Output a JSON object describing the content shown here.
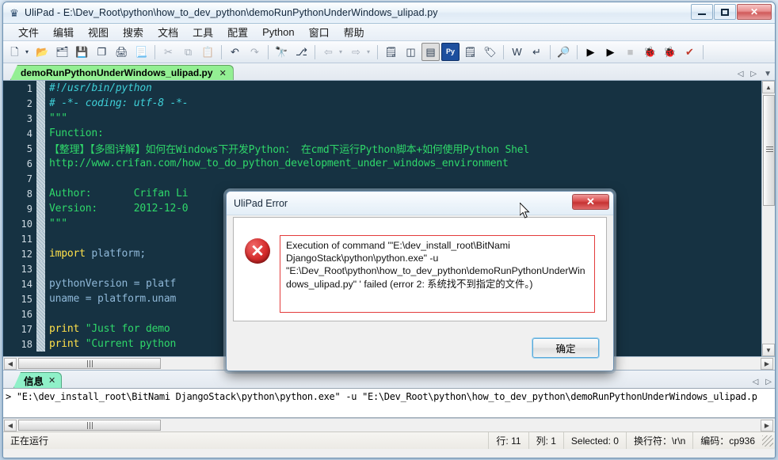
{
  "window": {
    "title": "UliPad - E:\\Dev_Root\\python\\how_to_dev_python\\demoRunPythonUnderWindows_ulipad.py",
    "app_icon": "ulipad-icon",
    "minimize_label": "–",
    "maximize_label": "□",
    "close_label": "✕"
  },
  "menubar": {
    "items": [
      {
        "label": "文件",
        "name": "menu-file"
      },
      {
        "label": "编辑",
        "name": "menu-edit"
      },
      {
        "label": "视图",
        "name": "menu-view"
      },
      {
        "label": "搜索",
        "name": "menu-search"
      },
      {
        "label": "文档",
        "name": "menu-document"
      },
      {
        "label": "工具",
        "name": "menu-tools"
      },
      {
        "label": "配置",
        "name": "menu-config"
      },
      {
        "label": "Python",
        "name": "menu-python"
      },
      {
        "label": "窗口",
        "name": "menu-window"
      },
      {
        "label": "帮助",
        "name": "menu-help"
      }
    ]
  },
  "toolbar": {
    "buttons": [
      {
        "name": "new-file-icon",
        "glyph": "🗋",
        "title": "New",
        "state": "normal"
      },
      {
        "name": "new-file-dropdown-icon",
        "glyph": "▾",
        "title": "New dropdown",
        "state": "arrow"
      },
      {
        "name": "open-file-icon",
        "glyph": "📂",
        "title": "Open",
        "state": "normal"
      },
      {
        "name": "open-folder-icon",
        "glyph": "🗂",
        "title": "Open folder",
        "state": "normal"
      },
      {
        "name": "save-icon",
        "glyph": "💾",
        "title": "Save",
        "state": "normal"
      },
      {
        "name": "save-all-icon",
        "glyph": "❐",
        "title": "Save all",
        "state": "normal"
      },
      {
        "name": "print-icon",
        "glyph": "🖨",
        "title": "Print",
        "state": "normal"
      },
      {
        "name": "print-preview-icon",
        "glyph": "📃",
        "title": "Print preview",
        "state": "normal"
      },
      {
        "name": "separator-1",
        "glyph": "",
        "title": "",
        "state": "sep"
      },
      {
        "name": "cut-icon",
        "glyph": "✂",
        "title": "Cut",
        "state": "dim"
      },
      {
        "name": "copy-icon",
        "glyph": "⧉",
        "title": "Copy",
        "state": "dim"
      },
      {
        "name": "paste-icon",
        "glyph": "📋",
        "title": "Paste",
        "state": "dim"
      },
      {
        "name": "separator-2",
        "glyph": "",
        "title": "",
        "state": "sep"
      },
      {
        "name": "undo-icon",
        "glyph": "↶",
        "title": "Undo",
        "state": "normal"
      },
      {
        "name": "redo-icon",
        "glyph": "↷",
        "title": "Redo",
        "state": "dim"
      },
      {
        "name": "separator-3",
        "glyph": "",
        "title": "",
        "state": "sep"
      },
      {
        "name": "find-icon",
        "glyph": "🔭",
        "title": "Find",
        "state": "normal"
      },
      {
        "name": "replace-icon",
        "glyph": "⎇",
        "title": "Replace",
        "state": "normal"
      },
      {
        "name": "separator-4",
        "glyph": "",
        "title": "",
        "state": "sep"
      },
      {
        "name": "back-icon",
        "glyph": "⇦",
        "title": "Back",
        "state": "dim"
      },
      {
        "name": "back-dropdown-icon",
        "glyph": "▾",
        "title": "Back history",
        "state": "arrow-dim"
      },
      {
        "name": "forward-icon",
        "glyph": "⇨",
        "title": "Forward",
        "state": "dim"
      },
      {
        "name": "forward-dropdown-icon",
        "glyph": "▾",
        "title": "Forward history",
        "state": "arrow-dim"
      },
      {
        "name": "separator-5",
        "glyph": "",
        "title": "",
        "state": "sep"
      },
      {
        "name": "preferences-icon",
        "glyph": "🗒",
        "title": "Preferences",
        "state": "normal"
      },
      {
        "name": "split-vertical-icon",
        "glyph": "◫",
        "title": "Split vertical",
        "state": "normal"
      },
      {
        "name": "split-horizontal-icon",
        "glyph": "▤",
        "title": "Split horizontal",
        "state": "pressed"
      },
      {
        "name": "python-shell-icon",
        "glyph": "Py",
        "title": "Python shell",
        "state": "normal"
      },
      {
        "name": "note-icon",
        "glyph": "🗒",
        "title": "Note",
        "state": "normal"
      },
      {
        "name": "tag-icon",
        "glyph": "🏷",
        "title": "Tag",
        "state": "normal"
      },
      {
        "name": "separator-6",
        "glyph": "",
        "title": "",
        "state": "sep"
      },
      {
        "name": "wrap-lines-icon",
        "glyph": "W",
        "title": "Wrap lines",
        "state": "normal"
      },
      {
        "name": "whitespace-icon",
        "glyph": "↵",
        "title": "Show whitespace",
        "state": "normal"
      },
      {
        "name": "separator-7",
        "glyph": "",
        "title": "",
        "state": "sep"
      },
      {
        "name": "inspect-icon",
        "glyph": "🔎",
        "title": "Inspect",
        "state": "normal"
      },
      {
        "name": "separator-8",
        "glyph": "",
        "title": "",
        "state": "sep"
      },
      {
        "name": "run-icon",
        "glyph": "▶",
        "title": "Run",
        "state": "normal"
      },
      {
        "name": "run-step-icon",
        "glyph": "▶",
        "title": "Run with arguments",
        "state": "normal"
      },
      {
        "name": "stop-icon",
        "glyph": "■",
        "title": "Stop",
        "state": "dim"
      },
      {
        "name": "debug-icon",
        "glyph": "🐞",
        "title": "Debug",
        "state": "normal"
      },
      {
        "name": "debug-run-icon",
        "glyph": "🐞",
        "title": "Debug run",
        "state": "normal"
      },
      {
        "name": "check-spelling-icon",
        "glyph": "✔",
        "title": "Check",
        "state": "normal"
      },
      {
        "name": "separator-9",
        "glyph": "",
        "title": "",
        "state": "sep"
      }
    ]
  },
  "tabbar": {
    "tabs": [
      {
        "label": "demoRunPythonUnderWindows_ulipad.py",
        "close": "✕",
        "active": true
      }
    ],
    "nav_prev": "◁",
    "nav_next": "▷",
    "nav_list": "▼"
  },
  "editor": {
    "lines": [
      {
        "no": "1",
        "segments": [
          {
            "t": "#!/usr/bin/python",
            "c": "c-comment"
          }
        ]
      },
      {
        "no": "2",
        "segments": [
          {
            "t": "# -*- coding: utf-8 -*-",
            "c": "c-comment"
          }
        ]
      },
      {
        "no": "3",
        "segments": [
          {
            "t": "\"\"\"",
            "c": "c-green"
          }
        ]
      },
      {
        "no": "4",
        "segments": [
          {
            "t": "Function:",
            "c": "c-green"
          }
        ]
      },
      {
        "no": "5",
        "segments": [
          {
            "t": "【整理】【多图详解】如何在Windows下开发Python： 在cmd下运行Python脚本+如何使用Python Shel",
            "c": "c-green"
          }
        ]
      },
      {
        "no": "6",
        "segments": [
          {
            "t": "http://www.crifan.com/how_to_do_python_development_under_windows_environment",
            "c": "c-green"
          }
        ]
      },
      {
        "no": "7",
        "segments": [
          {
            "t": "",
            "c": "c-green"
          }
        ]
      },
      {
        "no": "8",
        "segments": [
          {
            "t": "Author:       Crifan Li",
            "c": "c-green"
          }
        ]
      },
      {
        "no": "9",
        "segments": [
          {
            "t": "Version:      2012-12-0",
            "c": "c-green"
          }
        ]
      },
      {
        "no": "10",
        "segments": [
          {
            "t": "\"\"\"",
            "c": "c-green"
          }
        ]
      },
      {
        "no": "11",
        "segments": [
          {
            "t": "",
            "c": "c-green"
          }
        ]
      },
      {
        "no": "12",
        "segments": [
          {
            "t": "import ",
            "c": "c-kw"
          },
          {
            "t": "platform;",
            "c": "c-plain"
          }
        ]
      },
      {
        "no": "13",
        "segments": [
          {
            "t": "",
            "c": "c-green"
          }
        ]
      },
      {
        "no": "14",
        "segments": [
          {
            "t": "pythonVersion = platf",
            "c": "c-plain"
          }
        ]
      },
      {
        "no": "15",
        "segments": [
          {
            "t": "uname = platform.unam",
            "c": "c-plain"
          }
        ]
      },
      {
        "no": "16",
        "segments": [
          {
            "t": "",
            "c": "c-green"
          }
        ]
      },
      {
        "no": "17",
        "segments": [
          {
            "t": "print ",
            "c": "c-kw"
          },
          {
            "t": "\"Just for demo",
            "c": "c-string"
          }
        ]
      },
      {
        "no": "18",
        "segments": [
          {
            "t": "print ",
            "c": "c-kw"
          },
          {
            "t": "\"Current python",
            "c": "c-string"
          }
        ]
      }
    ]
  },
  "panel": {
    "tabs": [
      {
        "label": "信息",
        "close": "✕",
        "active": true
      }
    ],
    "output": "> \"E:\\dev_install_root\\BitNami DjangoStack\\python\\python.exe\" -u \"E:\\Dev_Root\\python\\how_to_dev_python\\demoRunPythonUnderWindows_ulipad.p",
    "nav_prev": "◁",
    "nav_next": "▷"
  },
  "statusbar": {
    "message": "正在运行",
    "line": "行: 11",
    "column": "列: 1",
    "selected": "Selected: 0",
    "eol": "换行符：\\r\\n",
    "encoding": "编码：cp936"
  },
  "dialog": {
    "title": "UliPad Error",
    "close_label": "✕",
    "icon": "error-icon",
    "icon_glyph": "✕",
    "message": "Execution of command '\"E:\\dev_install_root\\BitNami DjangoStack\\python\\python.exe\" -u \"E:\\Dev_Root\\python\\how_to_dev_python\\demoRunPythonUnderWindows_ulipad.py\" ' failed (error 2: 系统找不到指定的文件。)",
    "ok_label": "确定"
  },
  "colors": {
    "editor_bg": "#163242",
    "tab_green": "#93ef93",
    "panel_tab_green": "#8ff0c8",
    "error_red": "#e33c3c",
    "code_comment": "#3fd0d8",
    "code_string": "#2fd86a",
    "code_keyword": "#ffe04a"
  }
}
